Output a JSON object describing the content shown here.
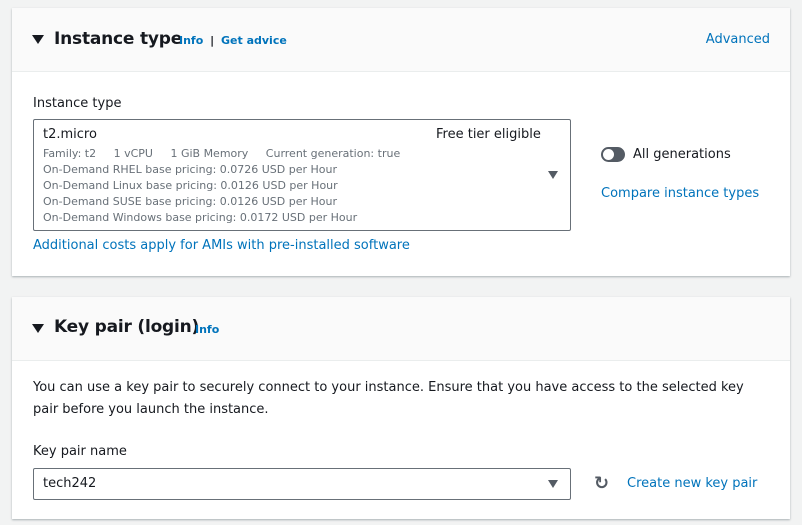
{
  "instance_type": {
    "title": "Instance type",
    "info": "Info",
    "separator": "|",
    "get_advice": "Get advice",
    "advanced": "Advanced",
    "field_label": "Instance type",
    "selected": "t2.micro",
    "badge": "Free tier eligible",
    "details": [
      "Family: t2",
      "1 vCPU",
      "1 GiB Memory",
      "Current generation: true"
    ],
    "pricing": [
      "On-Demand RHEL base pricing: 0.0726 USD per Hour",
      "On-Demand Linux base pricing: 0.0126 USD per Hour",
      "On-Demand SUSE base pricing: 0.0126 USD per Hour",
      "On-Demand Windows base pricing: 0.0172 USD per Hour"
    ],
    "additional_costs": "Additional costs apply for AMIs with pre-installed software",
    "all_generations": "All generations",
    "all_generations_on": false,
    "compare": "Compare instance types"
  },
  "key_pair": {
    "title": "Key pair (login)",
    "info": "Info",
    "description": "You can use a key pair to securely connect to your instance. Ensure that you have access to the selected key pair before you launch the instance.",
    "field_label": "Key pair name",
    "selected": "tech242",
    "create": "Create new key pair"
  }
}
